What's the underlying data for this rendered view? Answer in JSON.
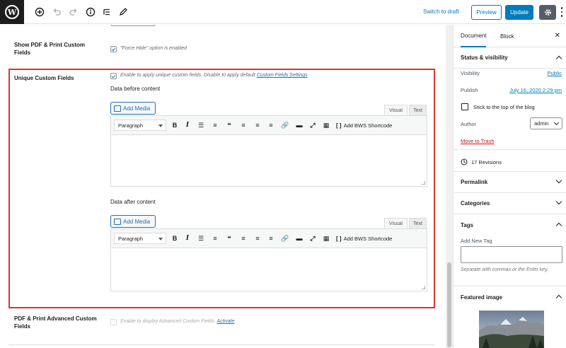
{
  "toolbar": {
    "switch_to_draft": "Switch to draft",
    "preview": "Preview",
    "update": "Update"
  },
  "fields": {
    "show_pdf_label": "Show PDF & Print Custom Fields",
    "show_pdf_note": "\"Force Hide\" option is enabled",
    "unique_label": "Unique Custom Fields",
    "unique_desc": "Enable to apply unique custom fields. Disable to apply default ",
    "unique_link": "Custom Fields Settings",
    "data_before": "Data before content",
    "data_after": "Data after content",
    "advanced_label": "PDF & Print Advanced Custom Fields",
    "advanced_desc": "Enable to display Advanced Custom Fields. ",
    "advanced_link": "Activate"
  },
  "editor": {
    "add_media": "Add Media",
    "tab_visual": "Visual",
    "tab_text": "Text",
    "format_select": "Paragraph",
    "bws_shortcode": "Add BWS Shortcode"
  },
  "sidebar": {
    "tab_document": "Document",
    "tab_block": "Block",
    "status_visibility": "Status & visibility",
    "visibility_label": "Visibility",
    "visibility_value": "Public",
    "publish_label": "Publish",
    "publish_value": "July 16, 2020 2:29 pm",
    "stick_top": "Stick to the top of the blog",
    "author_label": "Author",
    "author_value": "admin",
    "move_trash": "Move to Trash",
    "revisions": "17 Revisions",
    "permalink": "Permalink",
    "categories": "Categories",
    "tags": "Tags",
    "add_new_tag": "Add New Tag",
    "tag_help": "Separate with commas or the Enter key.",
    "featured_image": "Featured image"
  },
  "colors": {
    "accent": "#007cba",
    "highlight_border": "#d63638",
    "trash": "#cc1818"
  }
}
